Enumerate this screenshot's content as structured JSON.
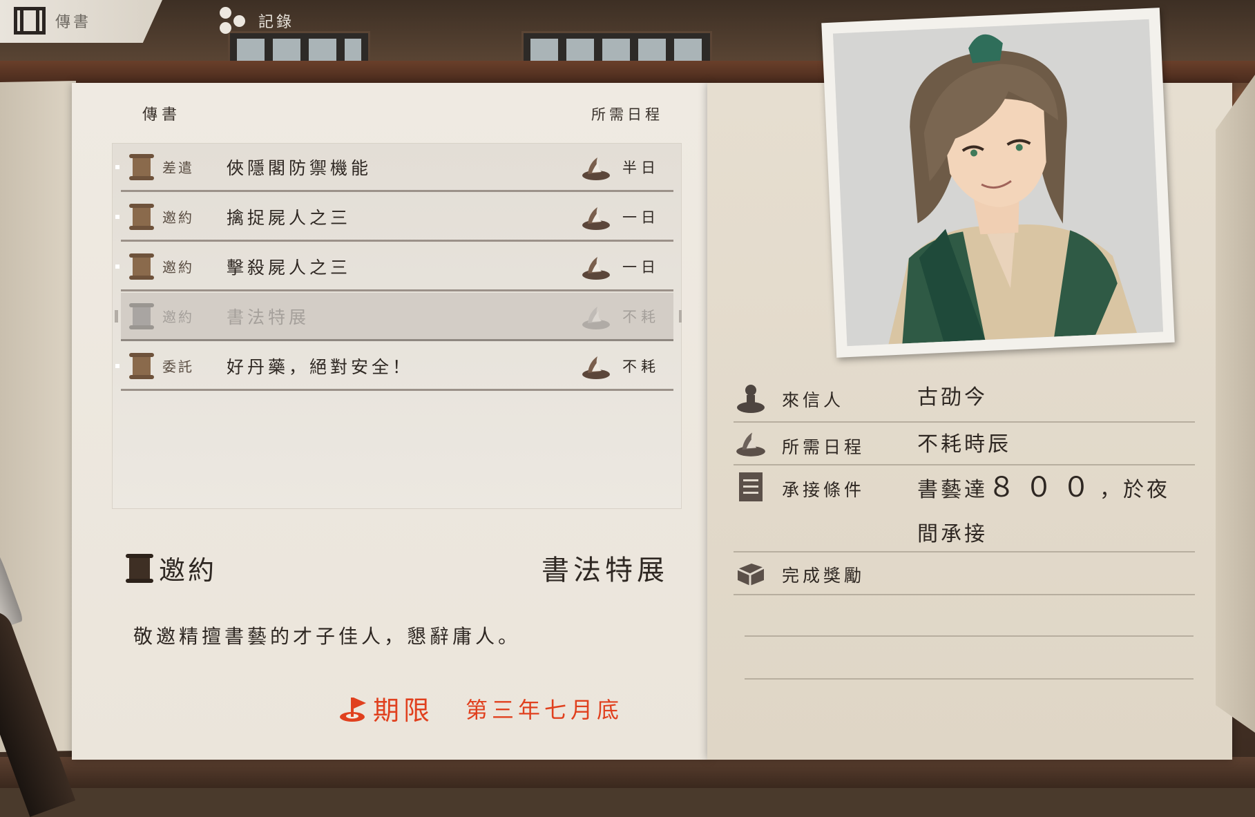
{
  "topbar": {
    "tabs": [
      {
        "label": "傳書",
        "active": true,
        "icon": "book-icon"
      },
      {
        "label": "記錄",
        "active": false,
        "icon": "dots-icon"
      }
    ]
  },
  "list": {
    "header_title": "傳書",
    "header_duration": "所需日程",
    "items": [
      {
        "category": "差遣",
        "title": "俠隱閣防禦機能",
        "duration": "半日",
        "selected": false
      },
      {
        "category": "邀約",
        "title": "擒捉屍人之三",
        "duration": "一日",
        "selected": false
      },
      {
        "category": "邀約",
        "title": "擊殺屍人之三",
        "duration": "一日",
        "selected": false
      },
      {
        "category": "邀約",
        "title": "書法特展",
        "duration": "不耗",
        "selected": true
      },
      {
        "category": "委託",
        "title": "好丹藥，絕對安全！",
        "duration": "不耗",
        "selected": false
      }
    ]
  },
  "detail": {
    "category": "邀約",
    "title": "書法特展",
    "description": "敬邀精擅書藝的才子佳人，懇辭庸人。",
    "deadline_label": "期限",
    "deadline_value": "第三年七月底"
  },
  "info": {
    "sender_label": "來信人",
    "sender_value": "古劭今",
    "duration_label": "所需日程",
    "duration_value": "不耗時辰",
    "condition_label": "承接條件",
    "condition_value_prefix": "書藝達",
    "condition_value_number": "８００",
    "condition_value_suffix": "，於夜間承接",
    "reward_label": "完成獎勵"
  },
  "colors": {
    "deadline_red": "#e0401e",
    "scroll_brown": "#8a6a4c",
    "ink": "#2e2722"
  }
}
